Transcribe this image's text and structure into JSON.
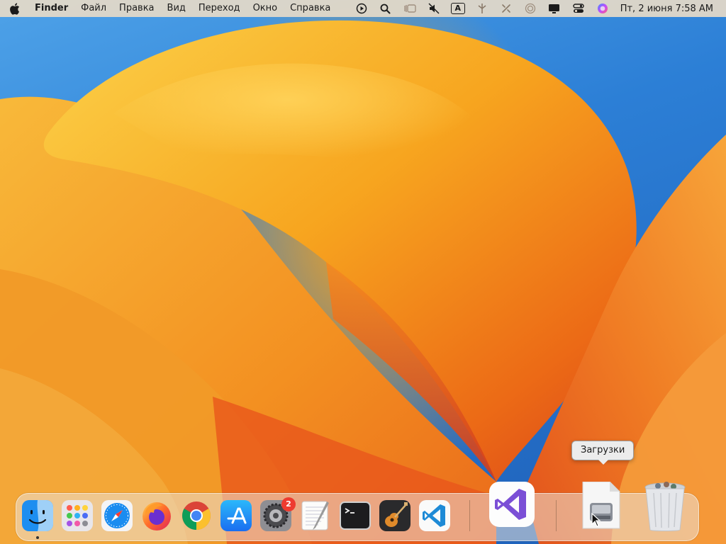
{
  "menubar": {
    "app_name": "Finder",
    "menus": [
      "Файл",
      "Правка",
      "Вид",
      "Переход",
      "Окно",
      "Справка"
    ],
    "input_source": "A",
    "clock": "Пт, 2 июня  7:58 AM"
  },
  "tooltip": {
    "text": "Загрузки"
  },
  "dock": {
    "apps": [
      {
        "name": "finder-icon"
      },
      {
        "name": "launchpad-icon"
      },
      {
        "name": "safari-icon"
      },
      {
        "name": "firefox-icon"
      },
      {
        "name": "chrome-icon"
      },
      {
        "name": "app-store-icon"
      },
      {
        "name": "system-settings-icon",
        "badge": "2"
      },
      {
        "name": "textedit-icon"
      },
      {
        "name": "terminal-icon"
      },
      {
        "name": "garageband-icon"
      },
      {
        "name": "vscode-icon"
      },
      {
        "name": "visual-studio-icon"
      },
      {
        "name": "downloads-stack-icon"
      },
      {
        "name": "trash-icon"
      }
    ]
  },
  "colors": {
    "wallpaper_orange": "#f59a1e",
    "wallpaper_blue": "#2c7fd6",
    "badge_red": "#ee3b30",
    "vs_purple": "#7b4fd6",
    "vscode_blue": "#1e8ad6"
  }
}
